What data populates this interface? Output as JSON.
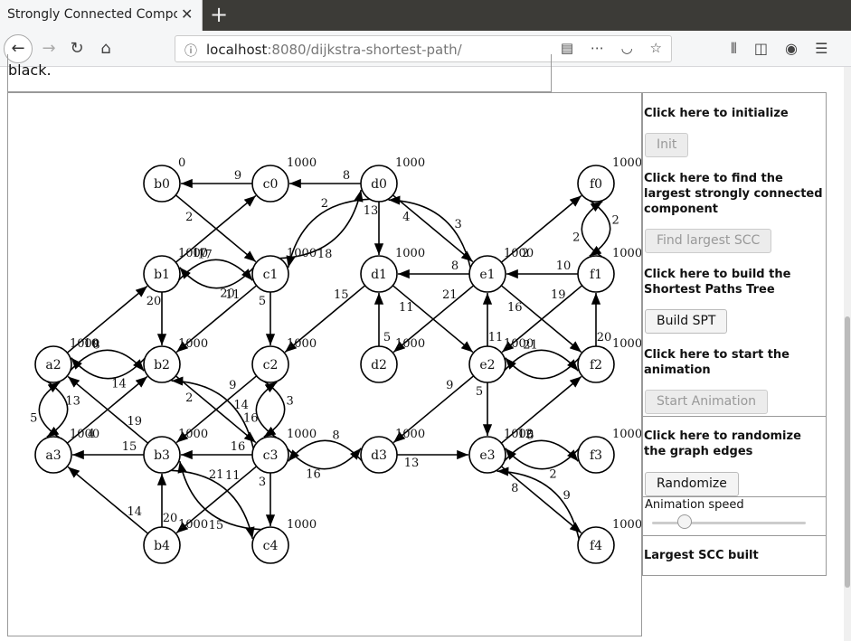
{
  "browser": {
    "tab_title": "Strongly Connected Compo",
    "tab_close": "✕",
    "new_tab": "+",
    "url_host": "localhost",
    "url_path": ":8080/dijkstra-shortest-path/"
  },
  "page": {
    "top_text": "black.",
    "side": {
      "init_label": "Click here to initialize",
      "init_button": "Init",
      "scc_label": "Click here to find the largest strongly connected component",
      "scc_button": "Find largest SCC",
      "spt_label": "Click here to build the Shortest Paths Tree",
      "spt_button": "Build SPT",
      "anim_label": "Click here to start the animation",
      "anim_button": "Start Animation",
      "random_label": "Click here to randomize the graph edges",
      "random_button": "Randomize",
      "speed_label": "Animation speed",
      "status": "Largest SCC built"
    }
  },
  "graph": {
    "nodes": [
      {
        "id": "b0",
        "d": "0"
      },
      {
        "id": "c0",
        "d": "1000"
      },
      {
        "id": "d0",
        "d": "1000"
      },
      {
        "id": "f0",
        "d": "1000"
      },
      {
        "id": "b1",
        "d": "1000"
      },
      {
        "id": "c1",
        "d": "1000"
      },
      {
        "id": "d1",
        "d": "1000"
      },
      {
        "id": "e1",
        "d": "1000"
      },
      {
        "id": "f1",
        "d": "1000"
      },
      {
        "id": "a2",
        "d": "1000"
      },
      {
        "id": "b2",
        "d": "1000"
      },
      {
        "id": "c2",
        "d": "1000"
      },
      {
        "id": "d2",
        "d": "1000"
      },
      {
        "id": "e2",
        "d": "1000"
      },
      {
        "id": "f2",
        "d": "1000"
      },
      {
        "id": "a3",
        "d": "1000"
      },
      {
        "id": "b3",
        "d": "1000"
      },
      {
        "id": "c3",
        "d": "1000"
      },
      {
        "id": "d3",
        "d": "1000"
      },
      {
        "id": "e3",
        "d": "1000"
      },
      {
        "id": "f3",
        "d": "1000"
      },
      {
        "id": "b4",
        "d": "1000"
      },
      {
        "id": "c4",
        "d": "1000"
      },
      {
        "id": "f4",
        "d": "1000"
      }
    ],
    "edges": [
      {
        "from": "c0",
        "to": "b0",
        "w": "9"
      },
      {
        "from": "d0",
        "to": "c0",
        "w": "8"
      },
      {
        "from": "b0",
        "to": "c1",
        "w": "2"
      },
      {
        "from": "b1",
        "to": "c0",
        "w": "17"
      },
      {
        "from": "b1",
        "to": "c1",
        "w": "17",
        "bend": -1
      },
      {
        "from": "c1",
        "to": "b1",
        "w": "20",
        "bend": -1
      },
      {
        "from": "d0",
        "to": "c1",
        "w": "2",
        "bend": 1
      },
      {
        "from": "c1",
        "to": "d0",
        "w": "18",
        "bend": 1
      },
      {
        "from": "d0",
        "to": "d1",
        "w": "13"
      },
      {
        "from": "d0",
        "to": "e1",
        "w": "4"
      },
      {
        "from": "e1",
        "to": "d0",
        "w": "3",
        "bend": 1
      },
      {
        "from": "e1",
        "to": "d1",
        "w": "8"
      },
      {
        "from": "e1",
        "to": "f0",
        "w": "2"
      },
      {
        "from": "f1",
        "to": "e1",
        "w": "10"
      },
      {
        "from": "f0",
        "to": "f1",
        "w": "2",
        "bend": -1
      },
      {
        "from": "f1",
        "to": "f0",
        "w": "2",
        "bend": -1
      },
      {
        "from": "a2",
        "to": "b1",
        "w": "10"
      },
      {
        "from": "b1",
        "to": "b2",
        "w": "20"
      },
      {
        "from": "c1",
        "to": "b2",
        "w": "11"
      },
      {
        "from": "c1",
        "to": "c2",
        "w": "5"
      },
      {
        "from": "d1",
        "to": "c2",
        "w": "15"
      },
      {
        "from": "d1",
        "to": "e2",
        "w": "11"
      },
      {
        "from": "e1",
        "to": "d2",
        "w": "21"
      },
      {
        "from": "e1",
        "to": "f2",
        "w": "16"
      },
      {
        "from": "f1",
        "to": "e2",
        "w": "19"
      },
      {
        "from": "e2",
        "to": "e1",
        "w": "11"
      },
      {
        "from": "f2",
        "to": "f1",
        "w": "20"
      },
      {
        "from": "d2",
        "to": "d1",
        "w": "5"
      },
      {
        "from": "a2",
        "to": "b2",
        "w": "8",
        "bend": -1
      },
      {
        "from": "b2",
        "to": "a2",
        "w": "14",
        "bend": -1
      },
      {
        "from": "a2",
        "to": "a3",
        "w": "13",
        "bend": -1
      },
      {
        "from": "a3",
        "to": "a2",
        "w": "5",
        "bend": -1
      },
      {
        "from": "b3",
        "to": "a2",
        "w": "19"
      },
      {
        "from": "a3",
        "to": "b2",
        "w": "4"
      },
      {
        "from": "c3",
        "to": "b2",
        "w": "14",
        "bend": 1
      },
      {
        "from": "b2",
        "to": "c3",
        "w": "2"
      },
      {
        "from": "c2",
        "to": "b3",
        "w": "9"
      },
      {
        "from": "c2",
        "to": "c3",
        "w": "3",
        "bend": -1
      },
      {
        "from": "c3",
        "to": "c2",
        "w": "16",
        "bend": -1
      },
      {
        "from": "e2",
        "to": "f2",
        "w": "21",
        "bend": -1
      },
      {
        "from": "f2",
        "to": "e2",
        "w": "",
        "bend": -1
      },
      {
        "from": "e2",
        "to": "d3",
        "w": "9"
      },
      {
        "from": "e2",
        "to": "e3",
        "w": "5"
      },
      {
        "from": "e3",
        "to": "f2",
        "w": "12"
      },
      {
        "from": "b3",
        "to": "a3",
        "w": "15"
      },
      {
        "from": "c3",
        "to": "b3",
        "w": "16"
      },
      {
        "from": "c3",
        "to": "d3",
        "w": "16",
        "bend": 1
      },
      {
        "from": "d3",
        "to": "c3",
        "w": "8",
        "bend": 1
      },
      {
        "from": "d3",
        "to": "e3",
        "w": "13"
      },
      {
        "from": "e3",
        "to": "f3",
        "w": "5",
        "bend": -1
      },
      {
        "from": "f3",
        "to": "e3",
        "w": "2",
        "bend": -1
      },
      {
        "from": "e3",
        "to": "f4",
        "w": "8"
      },
      {
        "from": "f4",
        "to": "e3",
        "w": "9",
        "bend": 1
      },
      {
        "from": "b4",
        "to": "a3",
        "w": "14"
      },
      {
        "from": "b4",
        "to": "b3",
        "w": "20"
      },
      {
        "from": "c3",
        "to": "b4",
        "w": "11"
      },
      {
        "from": "b3",
        "to": "c4",
        "w": "21",
        "bend": -1
      },
      {
        "from": "c4",
        "to": "b3",
        "w": "15",
        "bend": -1
      },
      {
        "from": "c3",
        "to": "c4",
        "w": "3"
      }
    ]
  }
}
